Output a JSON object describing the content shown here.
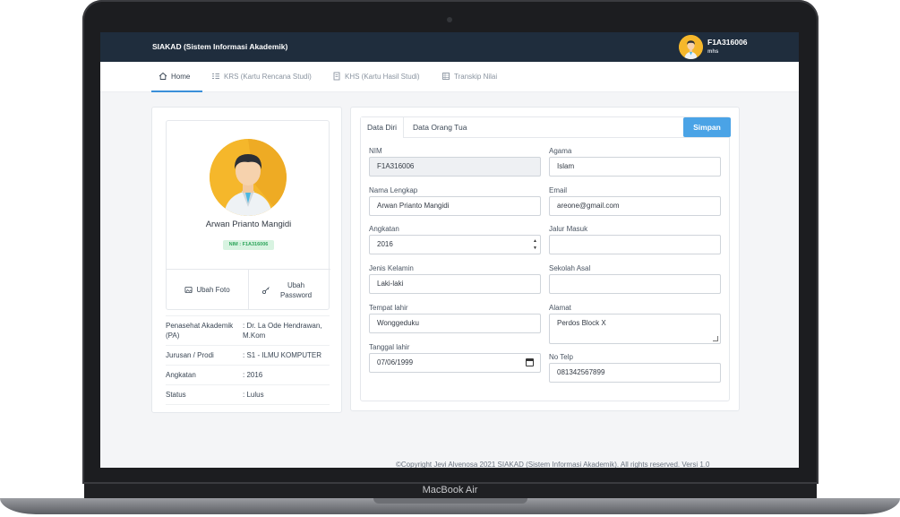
{
  "device_label": "MacBook Air",
  "app": {
    "title": "SIAKAD (Sistem Informasi Akademik)",
    "user_id": "F1A316006",
    "user_role": "mhs"
  },
  "nav": [
    {
      "label": "Home",
      "icon": "home-icon",
      "active": true
    },
    {
      "label": "KRS (Kartu Rencana Studi)",
      "icon": "list-icon",
      "active": false
    },
    {
      "label": "KHS (Kartu Hasil Studi)",
      "icon": "document-icon",
      "active": false
    },
    {
      "label": "Transkip Nilai",
      "icon": "table-icon",
      "active": false
    }
  ],
  "profile": {
    "name": "Arwan Prianto Mangidi",
    "nim_badge": "NIM : F1A316006",
    "change_photo": "Ubah Foto",
    "change_password": "Ubah Password",
    "info": [
      {
        "key": "Penasehat Akademik (PA)",
        "value": ": Dr. La Ode Hendrawan, M.Kom"
      },
      {
        "key": "Jurusan / Prodi",
        "value": ": S1 - ILMU KOMPUTER"
      },
      {
        "key": "Angkatan",
        "value": ": 2016"
      },
      {
        "key": "Status",
        "value": ": Lulus"
      }
    ]
  },
  "tabs": {
    "data_diri": "Data Diri",
    "data_orang_tua": "Data Orang Tua",
    "save": "Simpan"
  },
  "form": {
    "nim": {
      "label": "NIM",
      "value": "F1A316006"
    },
    "nama": {
      "label": "Nama Lengkap",
      "value": "Arwan Prianto Mangidi"
    },
    "angkatan": {
      "label": "Angkatan",
      "value": "2016"
    },
    "jenis_kelamin": {
      "label": "Jenis Kelamin",
      "value": "Laki-laki"
    },
    "tempat_lahir": {
      "label": "Tempat lahir",
      "value": "Wonggeduku"
    },
    "tanggal_lahir": {
      "label": "Tanggal lahir",
      "value": "07/06/1999"
    },
    "agama": {
      "label": "Agama",
      "value": "Islam"
    },
    "email": {
      "label": "Email",
      "value": "areone@gmail.com"
    },
    "jalur_masuk": {
      "label": "Jalur Masuk",
      "value": ""
    },
    "sekolah_asal": {
      "label": "Sekolah Asal",
      "value": ""
    },
    "alamat": {
      "label": "Alamat",
      "value": "Perdos Block X"
    },
    "no_telp": {
      "label": "No Telp",
      "value": "081342567899"
    }
  },
  "footer": "©Copyright Jevi Alvenosa 2021 SIAKAD (Sistem Informasi Akademik). All rights reserved. Versi 1.0"
}
